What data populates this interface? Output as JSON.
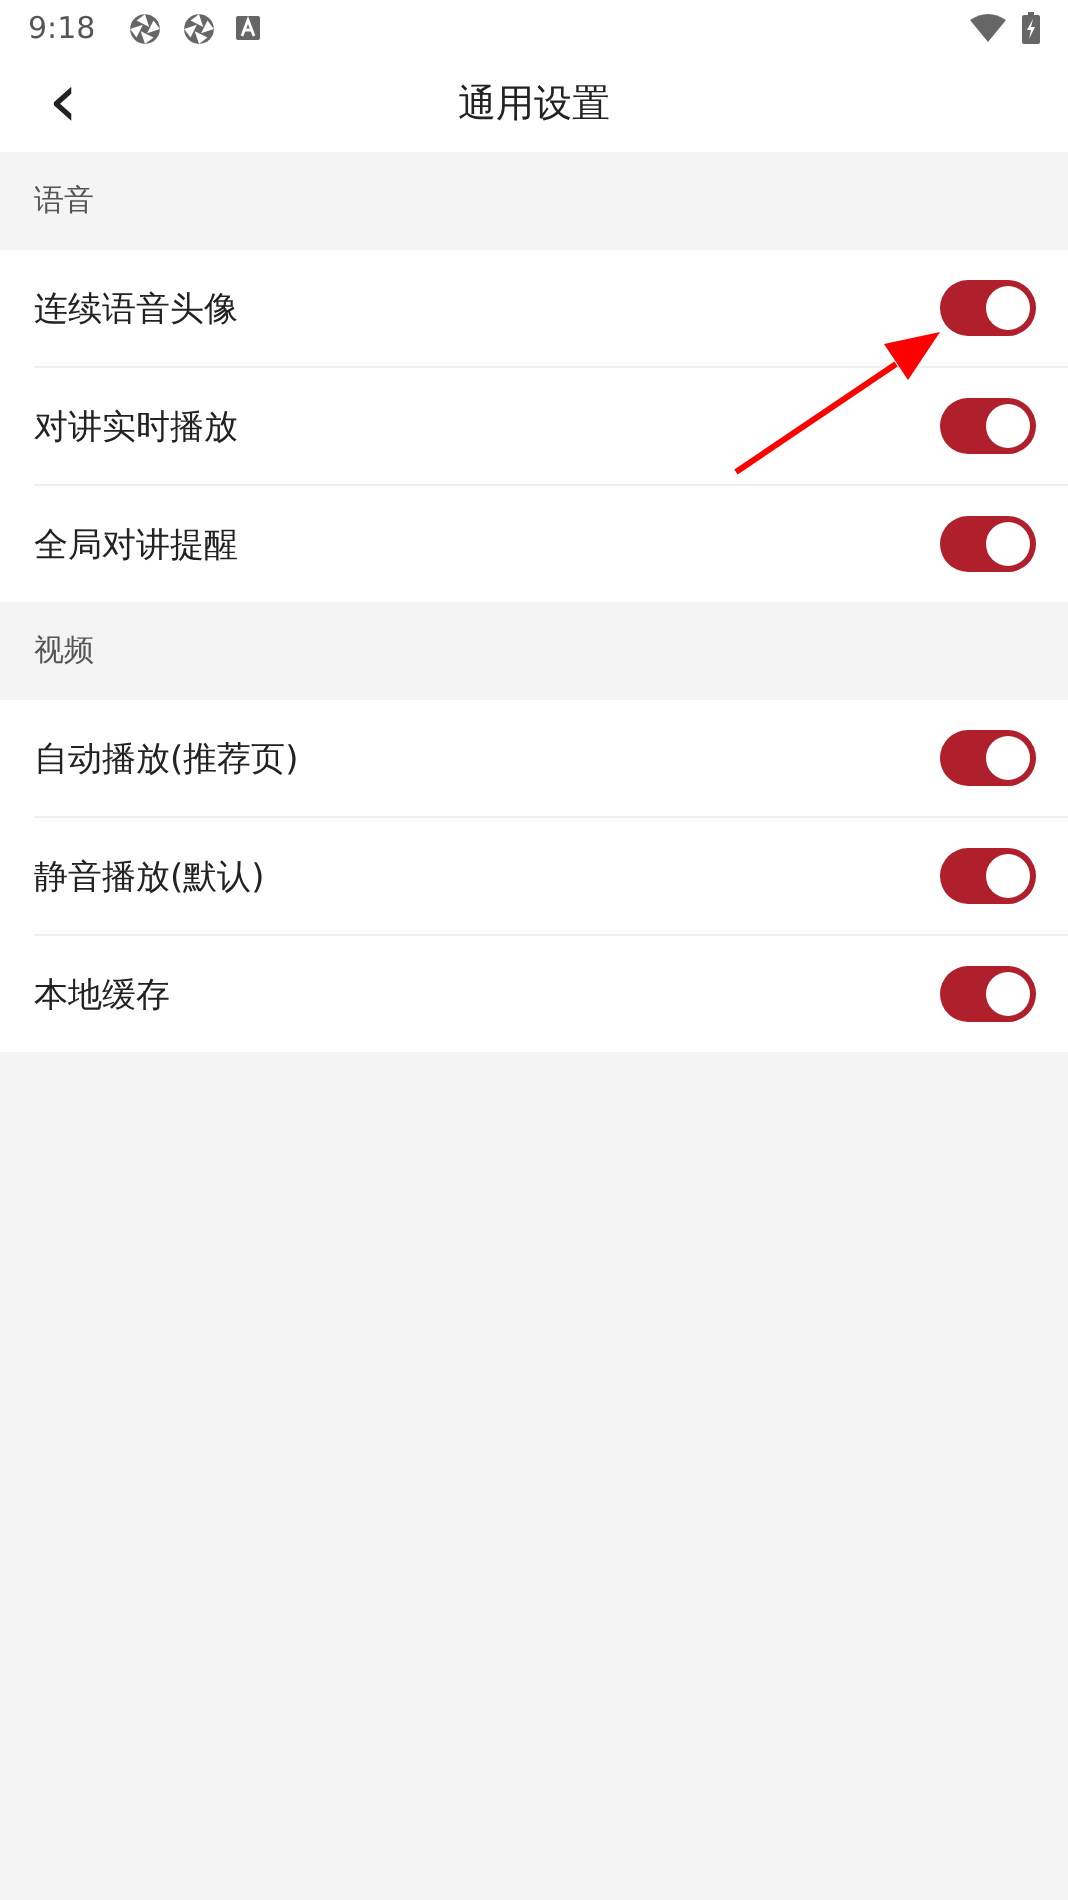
{
  "status_bar": {
    "time": "9:18"
  },
  "header": {
    "back": "‹",
    "title": "通用设置"
  },
  "sections": [
    {
      "title": "语音",
      "items": [
        {
          "label": "连续语音头像",
          "on": true
        },
        {
          "label": "对讲实时播放",
          "on": true
        },
        {
          "label": "全局对讲提醒",
          "on": true
        }
      ]
    },
    {
      "title": "视频",
      "items": [
        {
          "label": "自动播放(推荐页)",
          "on": true
        },
        {
          "label": "静音播放(默认)",
          "on": true
        },
        {
          "label": "本地缓存",
          "on": true
        }
      ]
    }
  ]
}
